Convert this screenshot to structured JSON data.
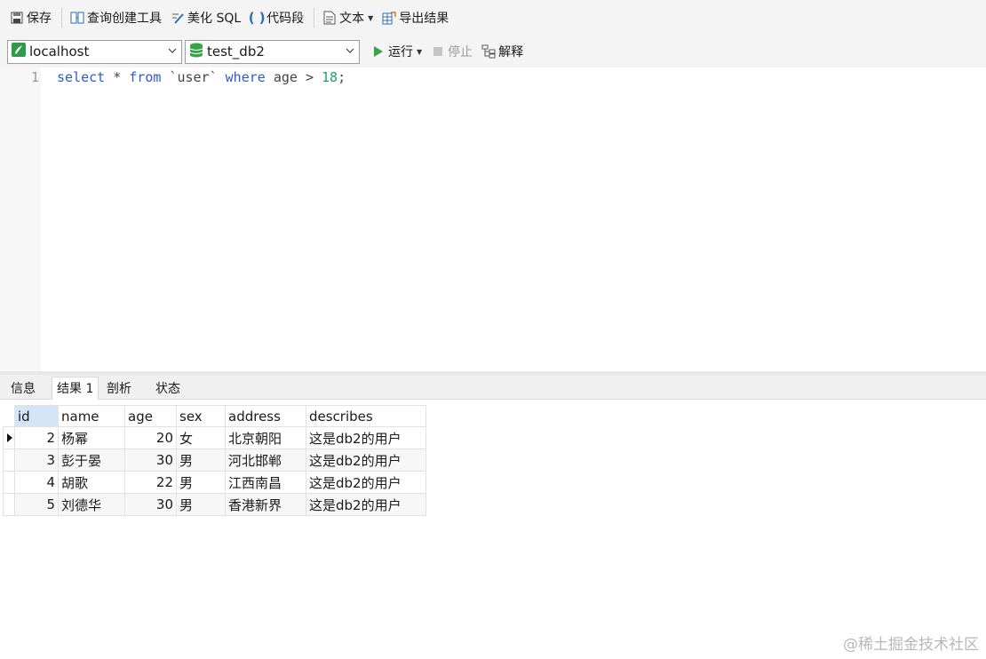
{
  "toolbar": {
    "save_label": "保存",
    "query_builder_label": "查询创建工具",
    "beautify_label": "美化 SQL",
    "snippet_label": "代码段",
    "text_label": "文本",
    "export_label": "导出结果"
  },
  "connection": {
    "server": "localhost",
    "database": "test_db2"
  },
  "run_controls": {
    "run_label": "运行",
    "stop_label": "停止",
    "explain_label": "解释"
  },
  "editor": {
    "line_number": "1",
    "tokens": {
      "select": "select",
      "star": " * ",
      "from": "from",
      "table": " `user` ",
      "where": "where",
      "cond": " age > ",
      "value": "18",
      "semi": ";"
    }
  },
  "result_tabs": [
    "信息",
    "结果 1",
    "剖析",
    "状态"
  ],
  "result_active_tab": "结果 1",
  "grid": {
    "columns": [
      "id",
      "name",
      "age",
      "sex",
      "address",
      "describes"
    ],
    "rows": [
      [
        "2",
        "杨幂",
        "20",
        "女",
        "北京朝阳",
        "这是db2的用户"
      ],
      [
        "3",
        "彭于晏",
        "30",
        "男",
        "河北邯郸",
        "这是db2的用户"
      ],
      [
        "4",
        "胡歌",
        "22",
        "男",
        "江西南昌",
        "这是db2的用户"
      ],
      [
        "5",
        "刘德华",
        "30",
        "男",
        "香港新界",
        "这是db2的用户"
      ]
    ]
  },
  "watermark": "@稀土掘金技术社区",
  "icons": {
    "save": "save-icon",
    "query_builder": "query-builder-icon",
    "beautify": "beautify-icon",
    "snippet": "snippet-icon",
    "text": "text-icon",
    "export": "export-icon",
    "server": "server-icon",
    "database": "database-icon",
    "run": "run-icon",
    "stop": "stop-icon",
    "explain": "explain-icon"
  },
  "colors": {
    "keyword": "#2b5ad0",
    "number": "#23a06b",
    "run_green": "#3aa34a",
    "selected_header": "#d5e4f7"
  }
}
